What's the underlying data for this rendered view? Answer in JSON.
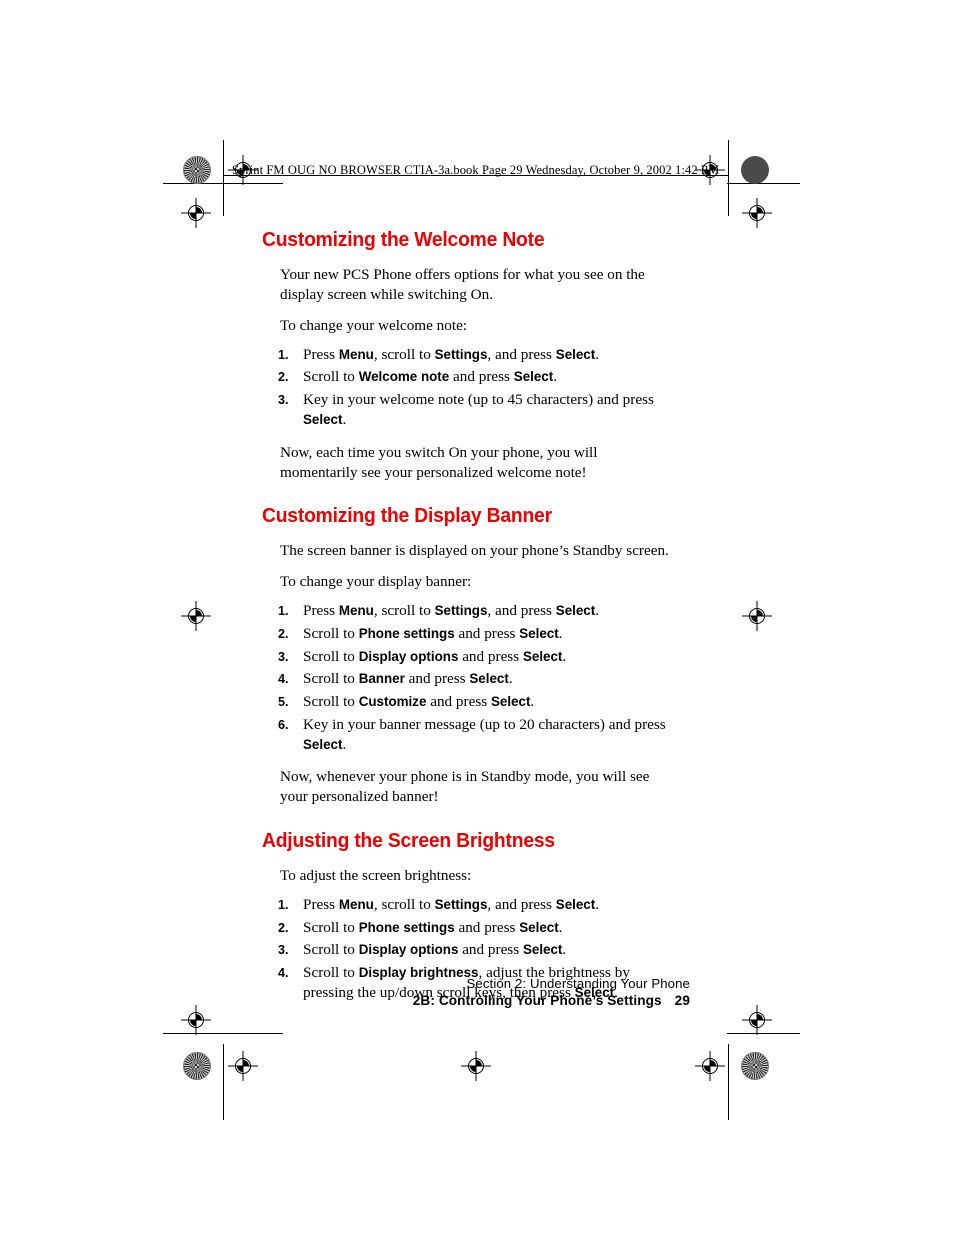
{
  "page_header": "Sprint FM OUG NO BROWSER CTIA-3a.book  Page 29  Wednesday, October 9, 2002  1:42 PM",
  "sections": [
    {
      "heading": "Customizing the Welcome Note",
      "intro": "Your new PCS Phone offers options for what you see on the display screen while switching On.",
      "lead_in": "To change your welcome note:",
      "steps": [
        {
          "num": "1.",
          "html": "Press <b>Menu</b>, scroll to <b>Settings</b>, and press <b>Select</b>."
        },
        {
          "num": "2.",
          "html": "Scroll to <b>Welcome note</b> and press <b>Select</b>."
        },
        {
          "num": "3.",
          "html": "Key in your welcome note (up to 45 characters) and press <b>Select</b>."
        }
      ],
      "outro": "Now, each time you switch On your phone, you will momentarily see your personalized welcome note!"
    },
    {
      "heading": "Customizing the Display Banner",
      "intro": "The screen banner is displayed on your phone’s Standby screen.",
      "lead_in": "To change your display banner:",
      "steps": [
        {
          "num": "1.",
          "html": "Press <b>Menu</b>, scroll to <b>Settings</b>, and press <b>Select</b>."
        },
        {
          "num": "2.",
          "html": "Scroll to <b>Phone settings</b> and press <b>Select</b>."
        },
        {
          "num": "3.",
          "html": "Scroll to <b>Display options</b> and press <b>Select</b>."
        },
        {
          "num": "4.",
          "html": "Scroll to <b>Banner</b> and press <b>Select</b>."
        },
        {
          "num": "5.",
          "html": "Scroll to <b>Customize</b> and press <b>Select</b>."
        },
        {
          "num": "6.",
          "html": "Key in your banner message (up to 20 characters) and press <b>Select</b>."
        }
      ],
      "outro": "Now, whenever your phone is in Standby mode, you will see your personalized banner!"
    },
    {
      "heading": "Adjusting the Screen Brightness",
      "intro": "",
      "lead_in": "To adjust the screen brightness:",
      "steps": [
        {
          "num": "1.",
          "html": "Press <b>Menu</b>, scroll to <b>Settings</b>, and press <b>Select</b>."
        },
        {
          "num": "2.",
          "html": "Scroll to <b>Phone settings</b> and press <b>Select</b>."
        },
        {
          "num": "3.",
          "html": "Scroll to <b>Display options</b> and press <b>Select</b>."
        },
        {
          "num": "4.",
          "html": "Scroll to <b>Display brightness</b>, adjust the brightness by pressing the up/down scroll keys, then press <b>Select</b>."
        }
      ],
      "outro": ""
    }
  ],
  "footer": {
    "section_line": "Section 2: Understanding Your Phone",
    "chapter_line": "2B: Controlling Your Phone’s Settings",
    "page_number": "29"
  },
  "colors": {
    "heading_red": "#ee0000",
    "text_black": "#000000",
    "page_white": "#ffffff"
  },
  "print_marks": {
    "registration_icon": "registration-target-icon",
    "density_patch_icon": "density-patch-icon",
    "star_target_icon": "star-target-icon"
  }
}
